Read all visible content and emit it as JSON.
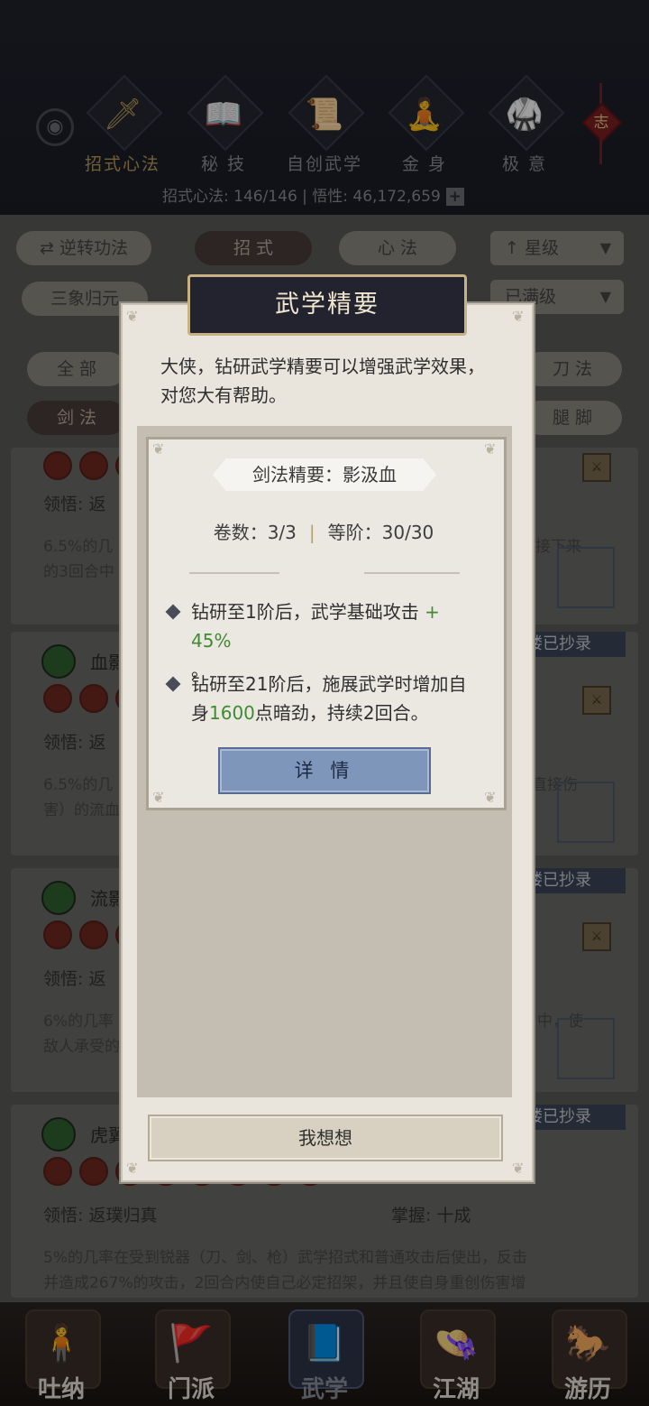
{
  "header": {
    "categories": [
      {
        "label": "招式心法",
        "icon": "sword-icon"
      },
      {
        "label": "秘 技",
        "icon": "book-icon"
      },
      {
        "label": "自创武学",
        "icon": "scroll-icon"
      },
      {
        "label": "金 身",
        "icon": "meditate-icon"
      },
      {
        "label": "极 意",
        "icon": "martial-pose-icon"
      }
    ],
    "knot_char": "志",
    "stats": "招式心法: 146/146 | 悟性: 46,172,659",
    "plus": "+"
  },
  "filters": {
    "reverse": "⇄ 逆转功法",
    "tab_moves": "招 式",
    "tab_heart": "心 法",
    "star_sort": "↑ 星级",
    "sanxiang": "三象归元",
    "maxed": "已满级",
    "all": "全 部",
    "sword": "剑 法",
    "blade": "刀 法",
    "leg": "腿 脚"
  },
  "list": {
    "items": [
      {
        "name": "",
        "wu": "领悟: 返",
        "desc": "6.5%的几",
        "desc2": "的3回合中",
        "right": "接下来"
      },
      {
        "name": "血影",
        "wu": "领悟: 返",
        "desc": "6.5%的几",
        "desc2": "害）的流血",
        "right": "直接伤",
        "ribbon": "楼已抄录"
      },
      {
        "name": "流影",
        "wu": "领悟: 返",
        "desc": "6%的几率",
        "desc2": "敌人承受的",
        "right": "中，使",
        "ribbon": "楼已抄录"
      },
      {
        "name": "虎翼",
        "wu": "领悟: 返璞归真",
        "mastery": "掌握: 十成",
        "desc": "5%的几率在受到锐器（刀、剑、枪）武学招式和普通攻击后使出，反击",
        "desc2": "并造成267%的攻击，2回合内使自己必定招架，并且使自身重创伤害增",
        "ribbon": "楼已抄录"
      }
    ]
  },
  "modal": {
    "title": "武学精要",
    "intro": "大侠，钻研武学精要可以增强武学效果，对您大有帮助。",
    "subtitle": "剑法精要：影汲血",
    "volume": "卷数：3/3",
    "sep": "|",
    "rank": "等阶：30/30",
    "bullet1_a": "钻研至1阶后，武学基础攻击 ",
    "bullet1_b": "+ 45%",
    "bullet1_c": "。",
    "bullet2_a": "钻研至21阶后，施展武学时增加自身",
    "bullet2_b": "1600",
    "bullet2_c": "点暗劲，持续2回合。",
    "detail_button": "详 情",
    "think_button": "我想想"
  },
  "nav": {
    "items": [
      {
        "label": "吐纳"
      },
      {
        "label": "门派"
      },
      {
        "label": "武学"
      },
      {
        "label": "江湖"
      },
      {
        "label": "游历"
      }
    ]
  }
}
